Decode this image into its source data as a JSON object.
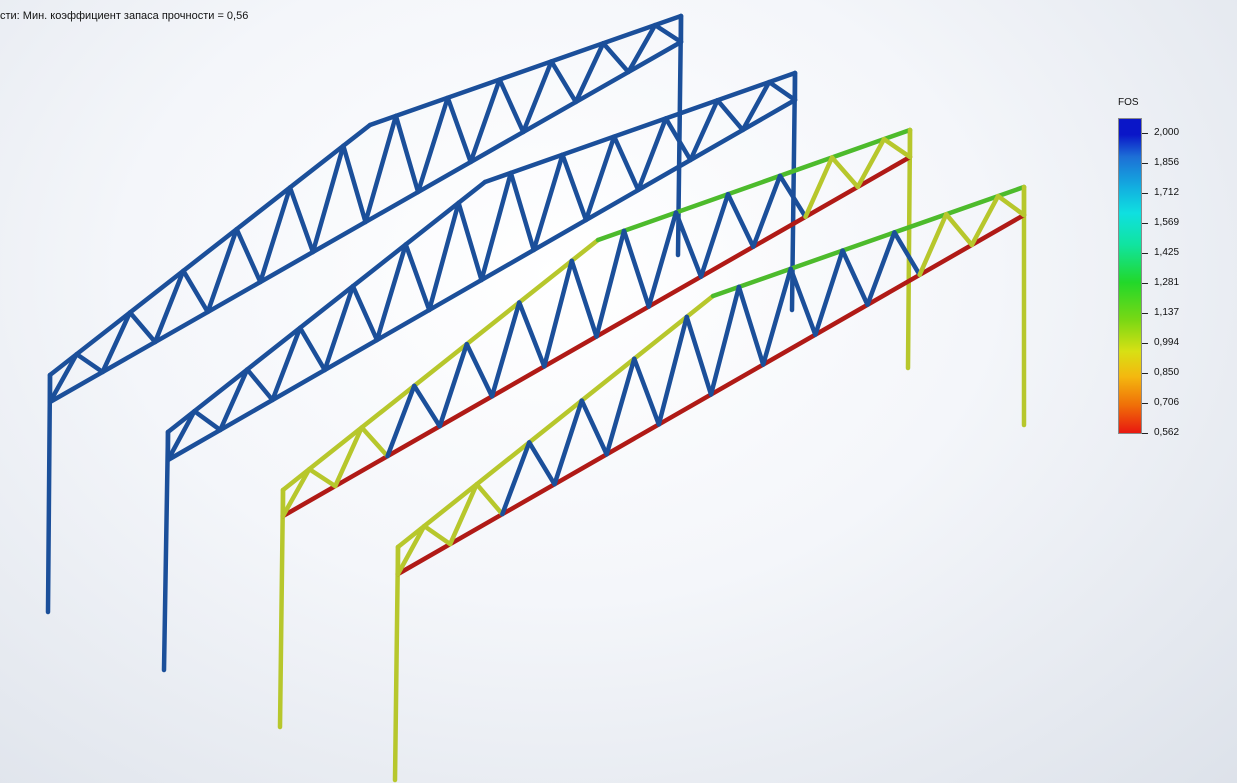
{
  "title": "сти: Мин. коэффициент запаса прочности = 0,56",
  "legend": {
    "title": "FOS",
    "ticks": [
      "2,000",
      "1,856",
      "1,712",
      "1,569",
      "1,425",
      "1,281",
      "1,137",
      "0,994",
      "0,850",
      "0,706",
      "0,562"
    ]
  },
  "colors": {
    "safe_blue": "#1b4f9a",
    "tension_red": "#b01a16",
    "chord_yellow": "#b7c72c",
    "chord_green": "#4dbb2c"
  }
}
